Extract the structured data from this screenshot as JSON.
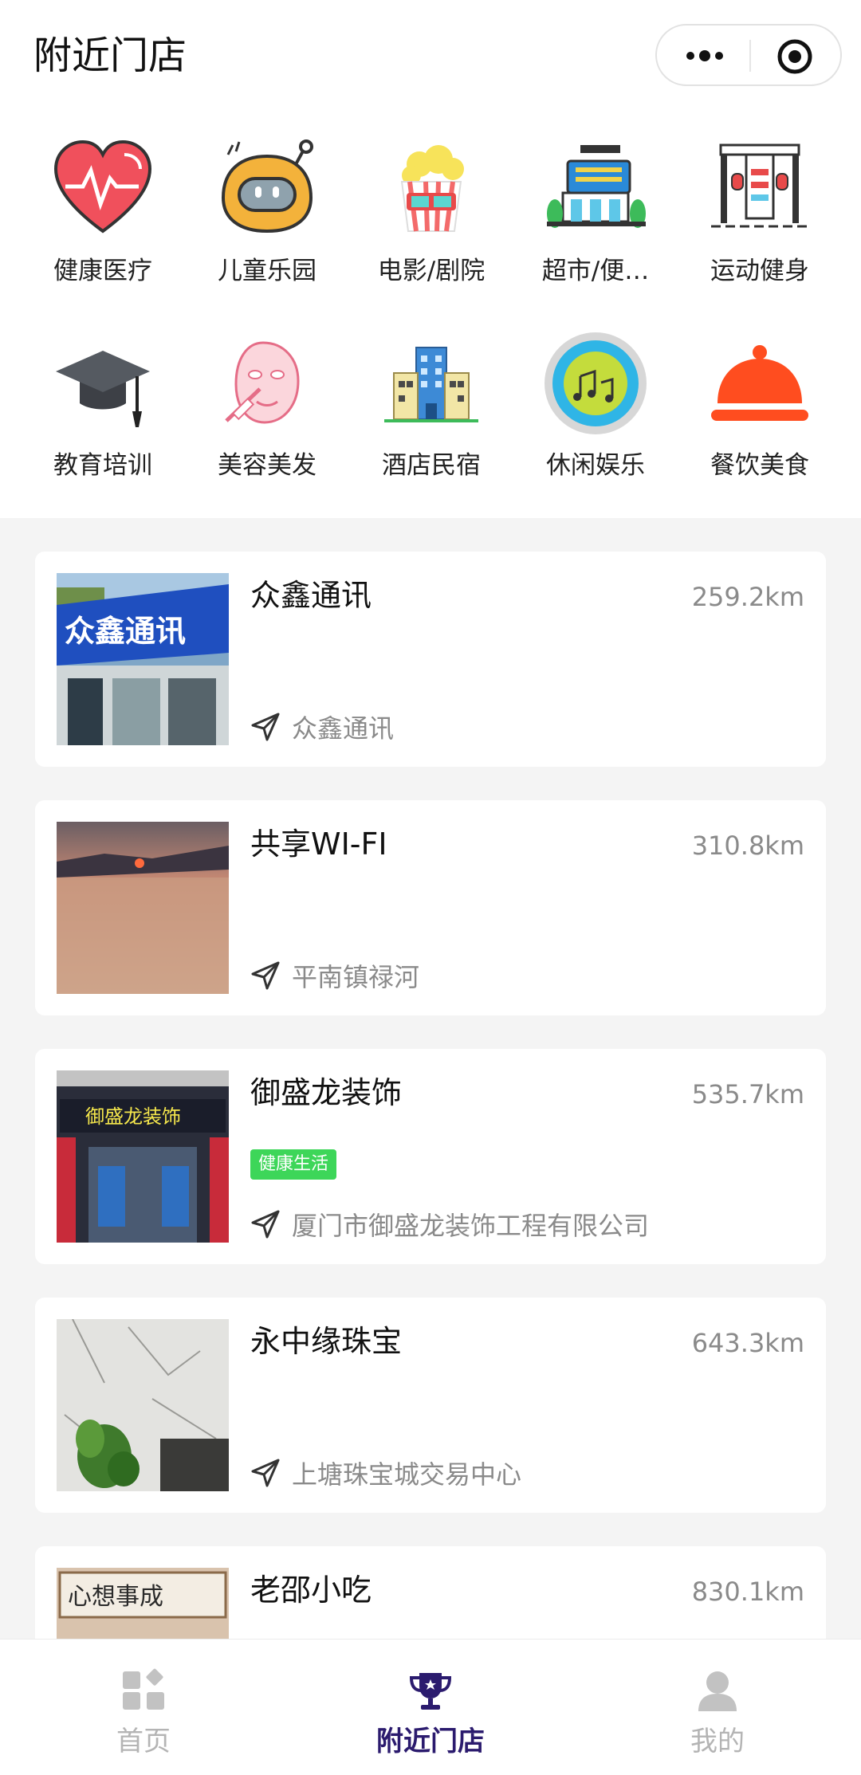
{
  "header": {
    "title": "附近门店"
  },
  "categories": [
    {
      "label": "健康医疗",
      "icon": "heart-pulse-icon"
    },
    {
      "label": "儿童乐园",
      "icon": "robot-toy-icon"
    },
    {
      "label": "电影/剧院",
      "icon": "popcorn-icon"
    },
    {
      "label": "超市/便…",
      "icon": "supermarket-cart-icon"
    },
    {
      "label": "运动健身",
      "icon": "gym-machine-icon"
    },
    {
      "label": "教育培训",
      "icon": "graduation-cap-icon"
    },
    {
      "label": "美容美发",
      "icon": "face-mask-icon"
    },
    {
      "label": "酒店民宿",
      "icon": "hotel-building-icon"
    },
    {
      "label": "休闲娱乐",
      "icon": "music-disc-icon"
    },
    {
      "label": "餐饮美食",
      "icon": "food-cloche-icon"
    }
  ],
  "stores": [
    {
      "name": "众鑫通讯",
      "distance": "259.2km",
      "tag": "",
      "address": "众鑫通讯"
    },
    {
      "name": "共享WI-FI",
      "distance": "310.8km",
      "tag": "",
      "address": "平南镇禄河"
    },
    {
      "name": "御盛龙装饰",
      "distance": "535.7km",
      "tag": "健康生活",
      "address": "厦门市御盛龙装饰工程有限公司"
    },
    {
      "name": "永中缘珠宝",
      "distance": "643.3km",
      "tag": "",
      "address": "上塘珠宝城交易中心"
    },
    {
      "name": "老邵小吃",
      "distance": "830.1km",
      "tag": "",
      "address": ""
    }
  ],
  "thumb_text": {
    "store1_sign": "众鑫通讯",
    "store3_sign": "御盛龙装饰",
    "store5_sign": "心想事成"
  },
  "tabbar": [
    {
      "label": "首页",
      "icon": "home-grid-icon",
      "active": false
    },
    {
      "label": "附近门店",
      "icon": "trophy-icon",
      "active": true
    },
    {
      "label": "我的",
      "icon": "user-icon",
      "active": false
    }
  ],
  "colors": {
    "active_tab": "#2b1b6e",
    "tag_bg": "#3dd659",
    "muted_text": "#8a8a8a"
  }
}
